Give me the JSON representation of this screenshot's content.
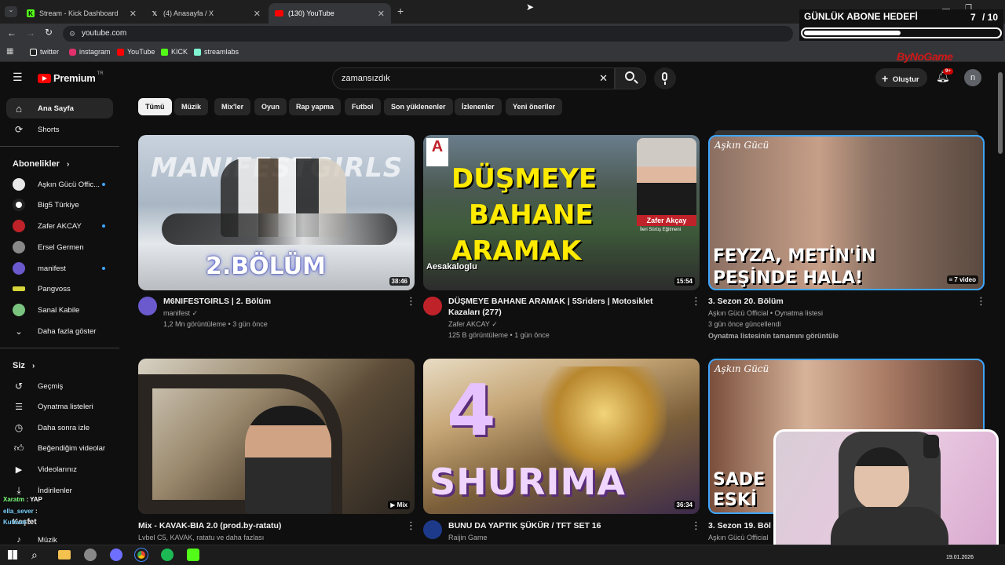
{
  "browser": {
    "tabs": [
      {
        "title": "Stream - Kick Dashboard",
        "icon": "kick-icon",
        "color": "#53fc18"
      },
      {
        "title": "(4) Anasayfa / X",
        "icon": "x-icon",
        "color": "#ffffff"
      },
      {
        "title": "(130) YouTube",
        "icon": "youtube-icon",
        "color": "#ff0000"
      }
    ],
    "url": "youtube.com",
    "bookmarks": [
      {
        "label": "twitter",
        "color": "#ffffff"
      },
      {
        "label": "instagram",
        "color": "#e1306c"
      },
      {
        "label": "YouTube",
        "color": "#ff0000"
      },
      {
        "label": "KICK",
        "color": "#53fc18"
      },
      {
        "label": "streamlabs",
        "color": "#80f5d2"
      }
    ]
  },
  "overlay": {
    "goal_title": "GÜNLÜK ABONE HEDEFİ",
    "goal_current": "7",
    "goal_target": "/ 10",
    "goal_progress": 0.7,
    "brand": "ByNoGame",
    "chat": [
      {
        "user": "Xaratm",
        "text": "YAP"
      },
      {
        "user": "ella_sever",
        "text": ":"
      },
      {
        "user": "Kufever",
        "text": ":"
      }
    ],
    "clock_date": "19.01.2026"
  },
  "youtube": {
    "logo": "Premium",
    "logo_badge": "TR",
    "search_value": "zamansızdık",
    "create_label": "Oluştur",
    "notif_count": "9+",
    "avatar_letter": "n",
    "chips": [
      "Tümü",
      "Müzik",
      "Mix'ler",
      "Oyun",
      "Rap yapma",
      "Futbol",
      "Son yüklenenler",
      "İzlenenler",
      "Yeni öneriler"
    ],
    "sidebar": {
      "main": [
        {
          "label": "Ana Sayfa",
          "icon": "home-icon"
        },
        {
          "label": "Shorts",
          "icon": "shorts-icon"
        }
      ],
      "subs_title": "Abonelikler",
      "subs": [
        {
          "label": "Aşkın Gücü Offic...",
          "color": "#e8e8e8"
        },
        {
          "label": "Big5 Türkiye",
          "color": "#ffffff"
        },
        {
          "label": "Zafer AKCAY",
          "color": "#c0222a"
        },
        {
          "label": "Ersel Germen",
          "color": "#888888"
        },
        {
          "label": "manifest",
          "color": "#6a5acd"
        },
        {
          "label": "Pangvoss",
          "color": "#d6d63a"
        },
        {
          "label": "Sanal Kabile",
          "color": "#7ac47f"
        }
      ],
      "show_more": "Daha fazla göster",
      "you_title": "Siz",
      "you": [
        {
          "label": "Geçmiş",
          "icon": "history-icon"
        },
        {
          "label": "Oynatma listeleri",
          "icon": "playlists-icon"
        },
        {
          "label": "Daha sonra izle",
          "icon": "watch-later-icon"
        },
        {
          "label": "Beğendiğim videolar",
          "icon": "like-icon"
        },
        {
          "label": "Videolarınız",
          "icon": "your-videos-icon"
        },
        {
          "label": "İndirilenler",
          "icon": "download-icon"
        }
      ],
      "explore_title": "Keşfet",
      "music": "Müzik"
    },
    "videos": [
      {
        "title": "M6NIFESTGIRLS | 2. Bölüm",
        "channel": "manifest",
        "verified": true,
        "meta": "1,2 Mn görüntüleme • 3 gün önce",
        "duration": "38:46",
        "overlay_text": "2.BÖLÜM",
        "brand_text": "MANIFESTGIRLS"
      },
      {
        "title": "DÜŞMEYE BAHANE ARAMAK | 5Sriders | Motosiklet Kazaları (277)",
        "channel": "Zafer AKCAY",
        "verified": true,
        "meta": "125 B görüntüleme • 1 gün önce",
        "duration": "15:54",
        "overlay_lines": [
          "DÜŞMEYE",
          "BAHANE",
          "ARAMAK"
        ],
        "person_name": "Zafer Akçay",
        "person_role": "İleri Sürüş Eğitmeni",
        "handle": "Aesakaloglu"
      },
      {
        "title": "3. Sezon 20. Bölüm",
        "channel": "Aşkın Gücü Official • Oynatma listesi",
        "meta": "3 gün önce güncellendi",
        "extra": "Oynatma listesinin tamamını görüntüle",
        "duration": "7 video",
        "overlay_lines": [
          "FEYZA, METİN'İN",
          "PEŞİNDE HALA!"
        ],
        "show_logo": "Aşkın Gücü"
      },
      {
        "title": "Mix - KAVAK-BIA 2.0 (prod.by-ratatu)",
        "channel": "Lvbel C5, KAVAK, ratatu ve daha fazlası",
        "meta": "",
        "duration": "Mix"
      },
      {
        "title": "BUNU DA YAPTIK ŞÜKÜR / TFT SET 16",
        "channel": "Raijin Game",
        "meta": "",
        "duration": "36:34",
        "overlay_lines": [
          "4",
          "SHURIMA"
        ]
      },
      {
        "title": "3. Sezon 19. Bölüm",
        "channel": "Aşkın Gücü Official",
        "meta": "",
        "overlay_lines": [
          "SADE",
          "ESKİ"
        ],
        "show_logo": "Aşkın Gücü"
      }
    ]
  }
}
